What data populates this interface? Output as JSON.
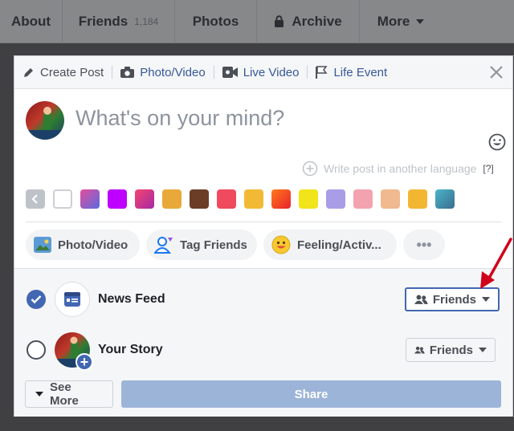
{
  "profile_nav": {
    "tabs": [
      {
        "label": "About"
      },
      {
        "label": "Friends",
        "count": "1,184"
      },
      {
        "label": "Photos"
      },
      {
        "label": "Archive"
      },
      {
        "label": "More"
      }
    ]
  },
  "composer": {
    "tabs": [
      {
        "label": "Create Post"
      },
      {
        "label": "Photo/Video"
      },
      {
        "label": "Live Video"
      },
      {
        "label": "Life Event"
      }
    ],
    "prompt_placeholder": "What's on your mind?",
    "language_link": "Write post in another language",
    "language_help": "[?]",
    "background_swatches": [
      {
        "bg": "#ffffff",
        "kind": "plain"
      },
      {
        "bg": "linear-gradient(135deg,#e44d9c,#5b6be0)",
        "kind": "pattern"
      },
      {
        "bg": "#bd00ff",
        "kind": "solid"
      },
      {
        "bg": "linear-gradient(135deg,#f5446e,#a52aa5)",
        "kind": "gradient"
      },
      {
        "bg": "#e8a93a",
        "kind": "emoji"
      },
      {
        "bg": "#6b3d26",
        "kind": "pattern"
      },
      {
        "bg": "#f04a5e",
        "kind": "pattern"
      },
      {
        "bg": "#f2b935",
        "kind": "emoji"
      },
      {
        "bg": "linear-gradient(135deg,#ff7a1a,#e8222d)",
        "kind": "gradient"
      },
      {
        "bg": "#f2e41a",
        "kind": "pattern"
      },
      {
        "bg": "#a89de6",
        "kind": "pattern"
      },
      {
        "bg": "#f3a3b0",
        "kind": "pattern"
      },
      {
        "bg": "#f0b98f",
        "kind": "pattern"
      },
      {
        "bg": "#f3b632",
        "kind": "emoji"
      },
      {
        "bg": "linear-gradient(135deg,#4bb4c9,#3a6e8f)",
        "kind": "gradient"
      }
    ],
    "actions": [
      {
        "label": "Photo/Video"
      },
      {
        "label": "Tag Friends"
      },
      {
        "label": "Feeling/Activ..."
      },
      {
        "label": "•••"
      }
    ],
    "destinations": [
      {
        "label": "News Feed",
        "checked": true,
        "audience": "Friends"
      },
      {
        "label": "Your Story",
        "checked": false,
        "audience": "Friends"
      }
    ],
    "see_more_label": "See More",
    "share_label": "Share"
  },
  "colors": {
    "brand_blue": "#4267b2",
    "link_blue": "#365899",
    "share_disabled": "#9cb4d8",
    "annotation_arrow": "#d0021b"
  }
}
